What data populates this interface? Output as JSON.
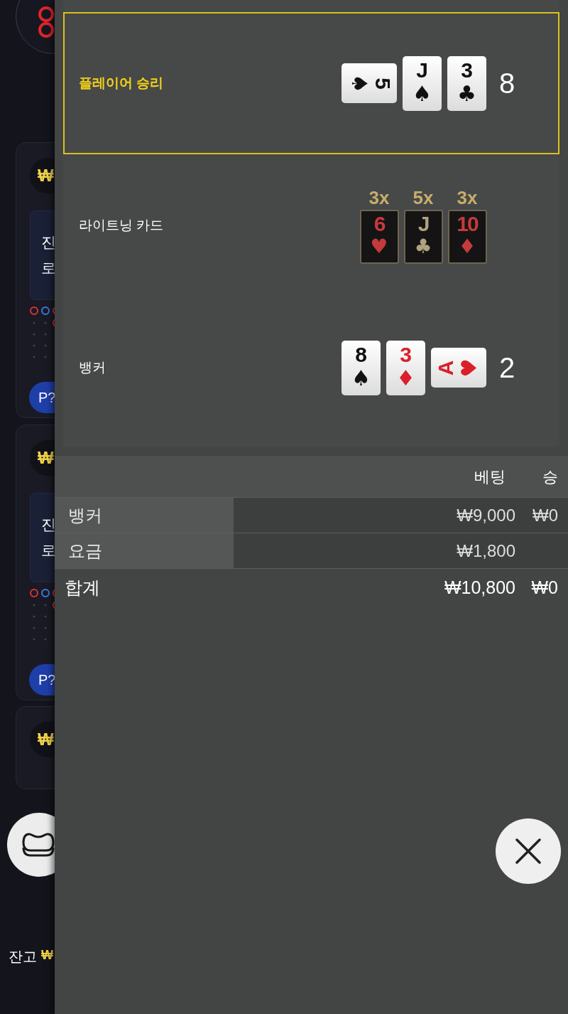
{
  "background": {
    "tables": [
      {
        "currency": "₩",
        "lines": [
          "진",
          "로"
        ],
        "button": "P?"
      },
      {
        "currency": "₩",
        "lines": [
          "진",
          "로"
        ],
        "button": "P?"
      },
      {
        "currency": "₩"
      }
    ],
    "balance": {
      "label": "잔고",
      "currency": "₩"
    }
  },
  "result_panel": {
    "rows": [
      {
        "label": "플레이어 승리",
        "winner": true,
        "kind": "hand",
        "cards": [
          {
            "rank": "5",
            "suit": "♠",
            "color": "#111111",
            "kind": "sideways_right"
          },
          {
            "rank": "J",
            "suit": "♠",
            "color": "#111111",
            "kind": "upright"
          },
          {
            "rank": "3",
            "suit": "♣",
            "color": "#111111",
            "kind": "upright"
          }
        ],
        "score": "8"
      },
      {
        "label": "라이트닝 카드",
        "winner": false,
        "kind": "lightning",
        "cards": [
          {
            "multiplier": "3x",
            "rank": "6",
            "suit": "♥",
            "color": "#c53a3c"
          },
          {
            "multiplier": "5x",
            "rank": "J",
            "suit": "♣",
            "color": "#b0a280"
          },
          {
            "multiplier": "3x",
            "rank": "10",
            "suit": "♦",
            "color": "#c53a3c"
          }
        ]
      },
      {
        "label": "뱅커",
        "winner": false,
        "kind": "hand",
        "cards": [
          {
            "rank": "8",
            "suit": "♠",
            "color": "#111111",
            "kind": "upright"
          },
          {
            "rank": "3",
            "suit": "♦",
            "color": "#d9202a",
            "kind": "upright"
          },
          {
            "rank": "A",
            "suit": "♥",
            "color": "#d9202a",
            "kind": "sideways_left"
          }
        ],
        "score": "2"
      }
    ]
  },
  "bet_table": {
    "columns": [
      "베팅",
      "승"
    ],
    "rows": [
      {
        "label": "뱅커",
        "bet": "₩9,000",
        "win": "₩0"
      },
      {
        "label": "요금",
        "bet": "₩1,800"
      }
    ],
    "total": {
      "label": "합계",
      "bet": "₩10,800",
      "win": "₩0"
    }
  }
}
